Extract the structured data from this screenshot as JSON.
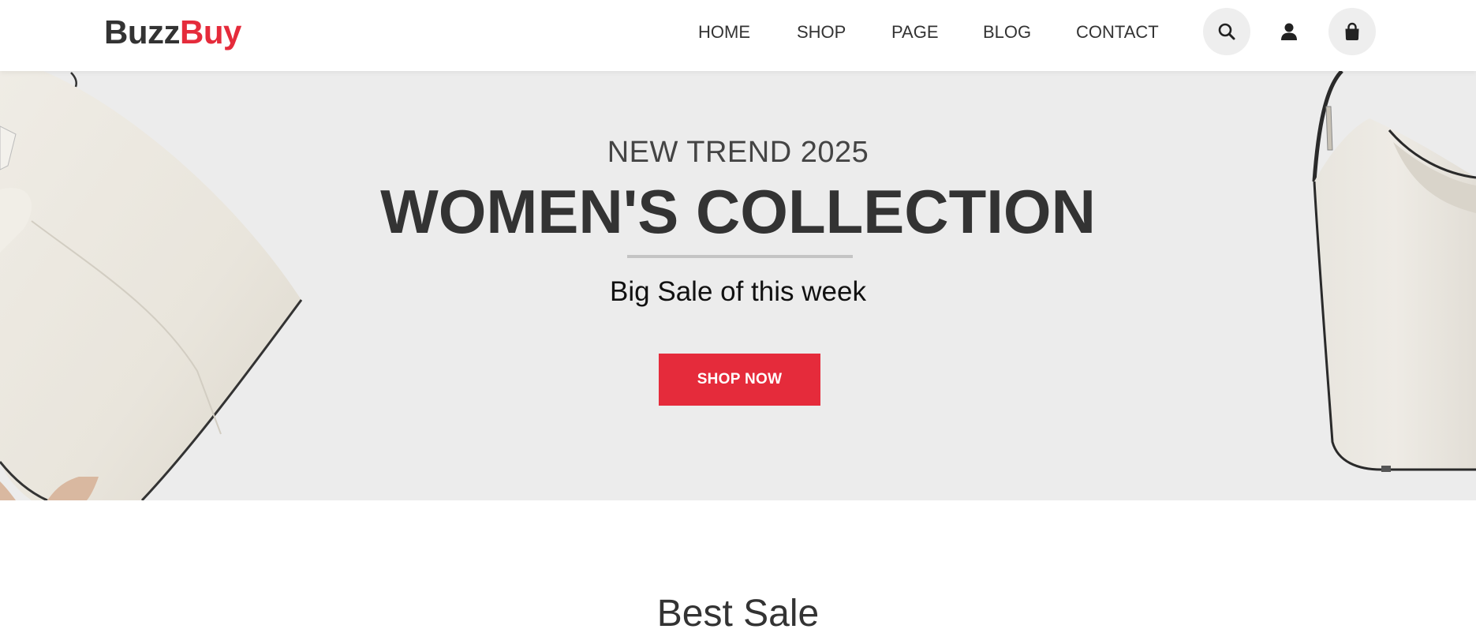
{
  "brand": {
    "part1": "Buzz",
    "part2": "Buy"
  },
  "nav": {
    "items": [
      {
        "label": "HOME"
      },
      {
        "label": "SHOP"
      },
      {
        "label": "PAGE"
      },
      {
        "label": "BLOG"
      },
      {
        "label": "CONTACT"
      }
    ]
  },
  "header_icons": [
    "search-icon",
    "user-icon",
    "shopping-bag-icon"
  ],
  "hero": {
    "subtitle": "NEW TREND 2025",
    "title": "WOMEN'S COLLECTION",
    "tagline": "Big Sale of this week",
    "cta_label": "SHOP NOW"
  },
  "sections": {
    "best_sale_title": "Best Sale"
  },
  "colors": {
    "accent": "#e52b3b",
    "text": "#333333",
    "hero_bg": "#ececec"
  }
}
